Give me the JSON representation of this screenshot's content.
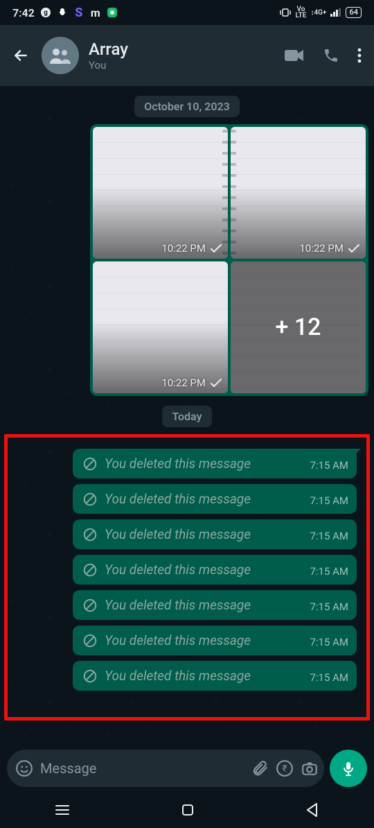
{
  "status": {
    "time": "7:42",
    "battery": "64",
    "right_labels": [
      "Vo",
      "LTE",
      "4G+"
    ],
    "left_icons": [
      "g",
      "snap",
      "S",
      "m",
      "app"
    ]
  },
  "header": {
    "title": "Array",
    "subtitle": "You"
  },
  "dates": {
    "prev": "October 10, 2023",
    "today": "Today"
  },
  "album": {
    "cells": [
      {
        "time": "10:22 PM"
      },
      {
        "time": "10:22 PM"
      },
      {
        "time": "10:22 PM"
      },
      {
        "more_label": "+ 12"
      }
    ]
  },
  "deleted": {
    "text": "You deleted this message",
    "items": [
      {
        "time": "7:15 AM"
      },
      {
        "time": "7:15 AM"
      },
      {
        "time": "7:15 AM"
      },
      {
        "time": "7:15 AM"
      },
      {
        "time": "7:15 AM"
      },
      {
        "time": "7:15 AM"
      },
      {
        "time": "7:15 AM"
      }
    ]
  },
  "composer": {
    "placeholder": "Message"
  }
}
